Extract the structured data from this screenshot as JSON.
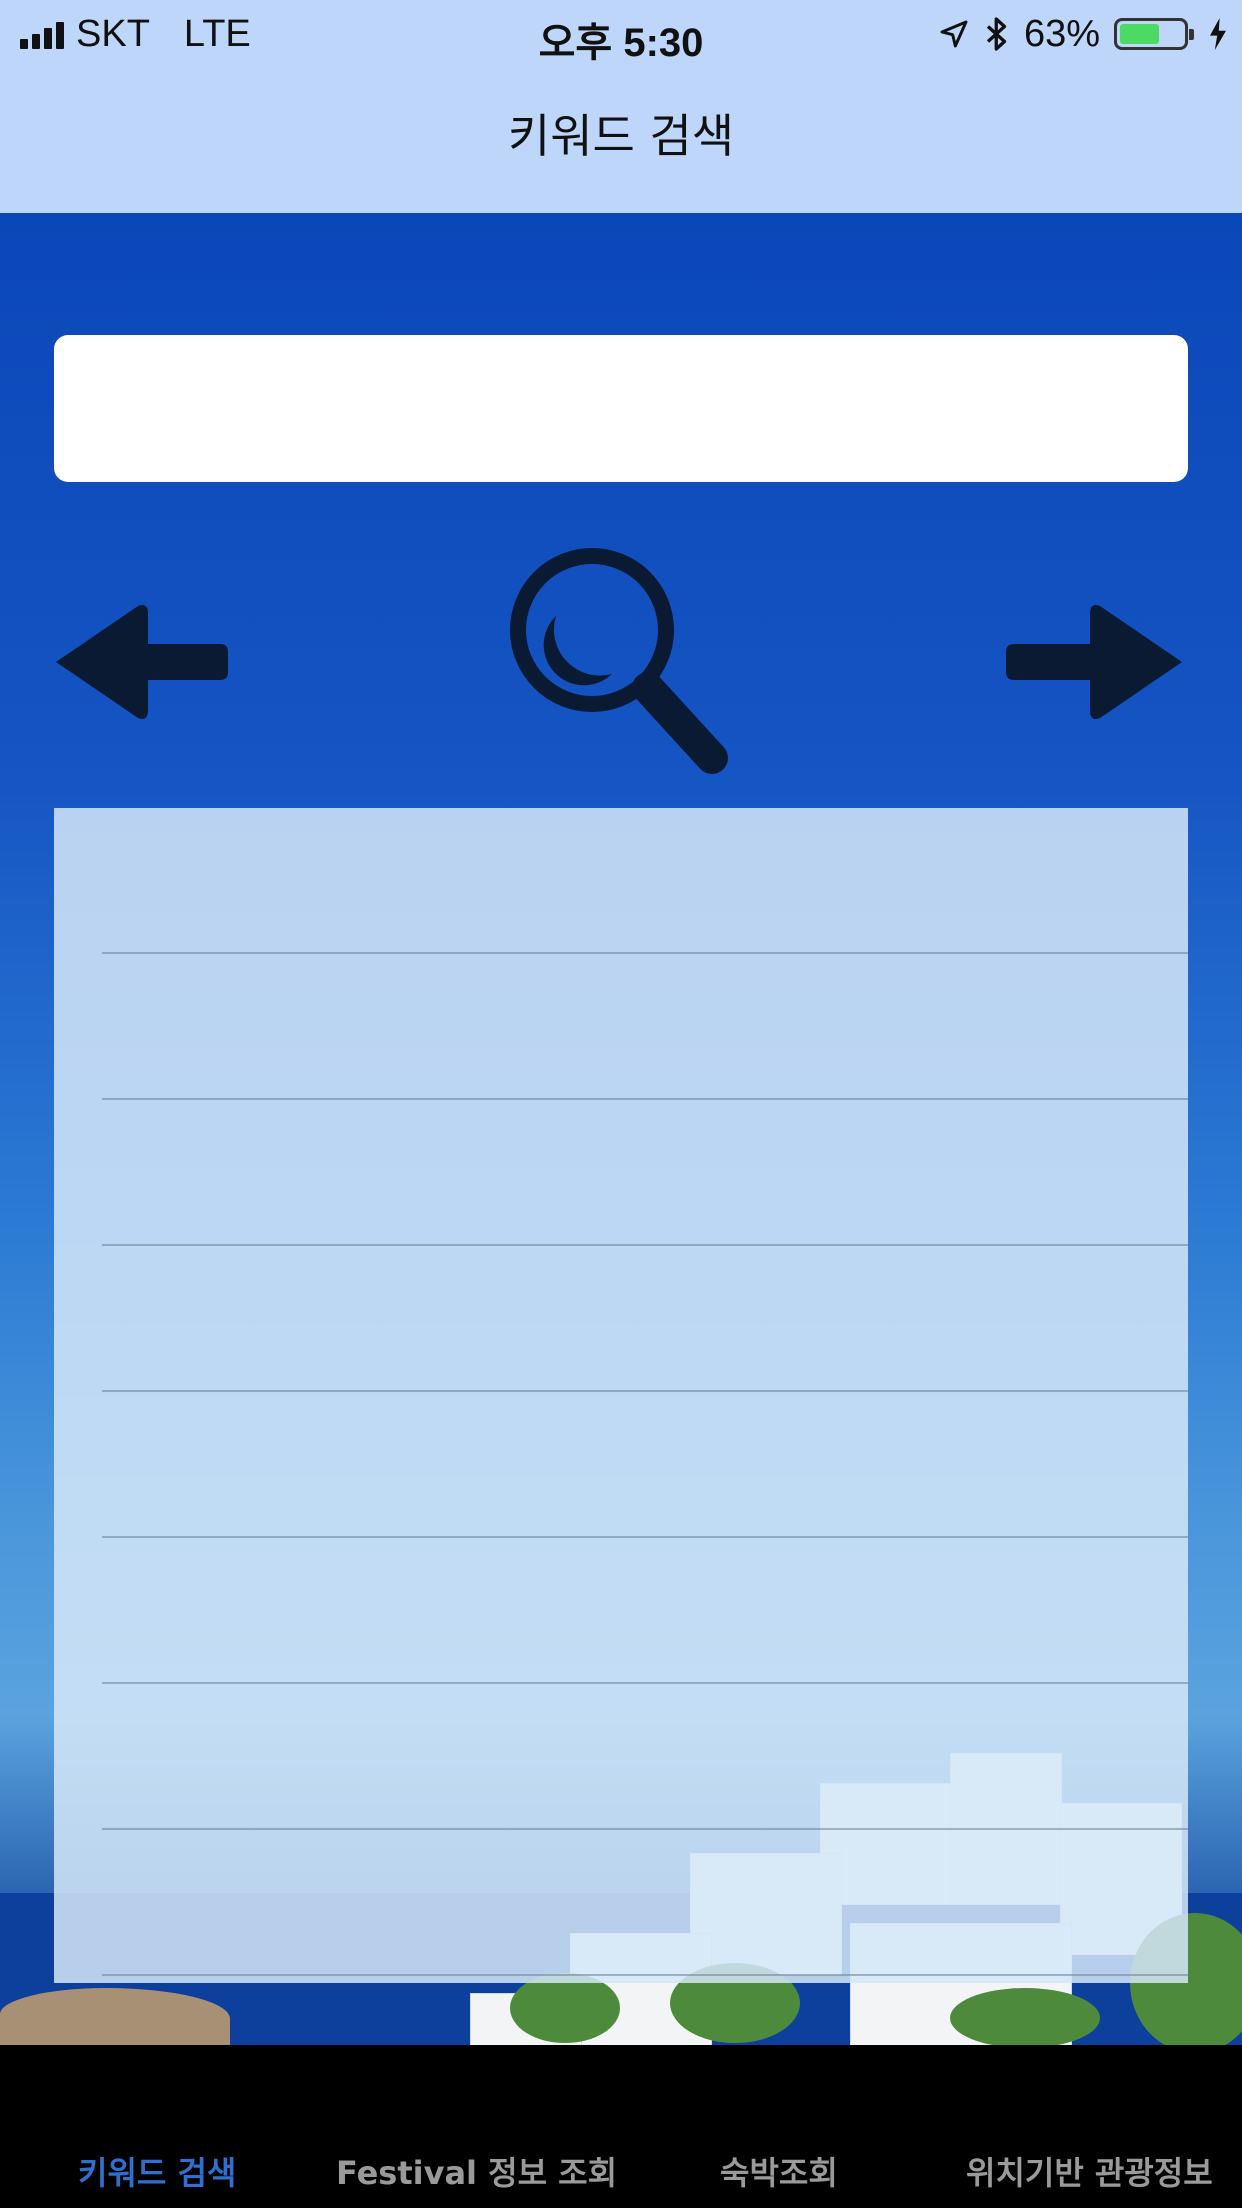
{
  "status_bar": {
    "carrier": "SKT",
    "network": "LTE",
    "time": "오후 5:30",
    "battery_percent": "63%",
    "battery_level": 0.63,
    "icons": [
      "signal-icon",
      "location-icon",
      "bluetooth-icon",
      "battery-icon",
      "charging-icon"
    ]
  },
  "nav": {
    "title": "키워드 검색"
  },
  "search": {
    "value": "",
    "placeholder": ""
  },
  "toolbar": {
    "prev_icon": "arrow-left-icon",
    "search_icon": "magnifier-icon",
    "next_icon": "arrow-right-icon"
  },
  "results": {
    "rows": [
      "",
      "",
      "",
      "",
      "",
      "",
      "",
      ""
    ]
  },
  "tabs": [
    {
      "label": "키워드 검색",
      "active": true
    },
    {
      "label": "Festival 정보 조회",
      "active": false
    },
    {
      "label": "숙박조회",
      "active": false
    },
    {
      "label": "위치기반 관광정보",
      "active": false
    }
  ],
  "colors": {
    "nav_background": "#bdd6fa",
    "content_blue": "#0b47b8",
    "icon_dark": "#0b1a33",
    "tab_active": "#2f6fd0",
    "tab_inactive": "#9a9a9a",
    "battery_green": "#4cd964"
  }
}
